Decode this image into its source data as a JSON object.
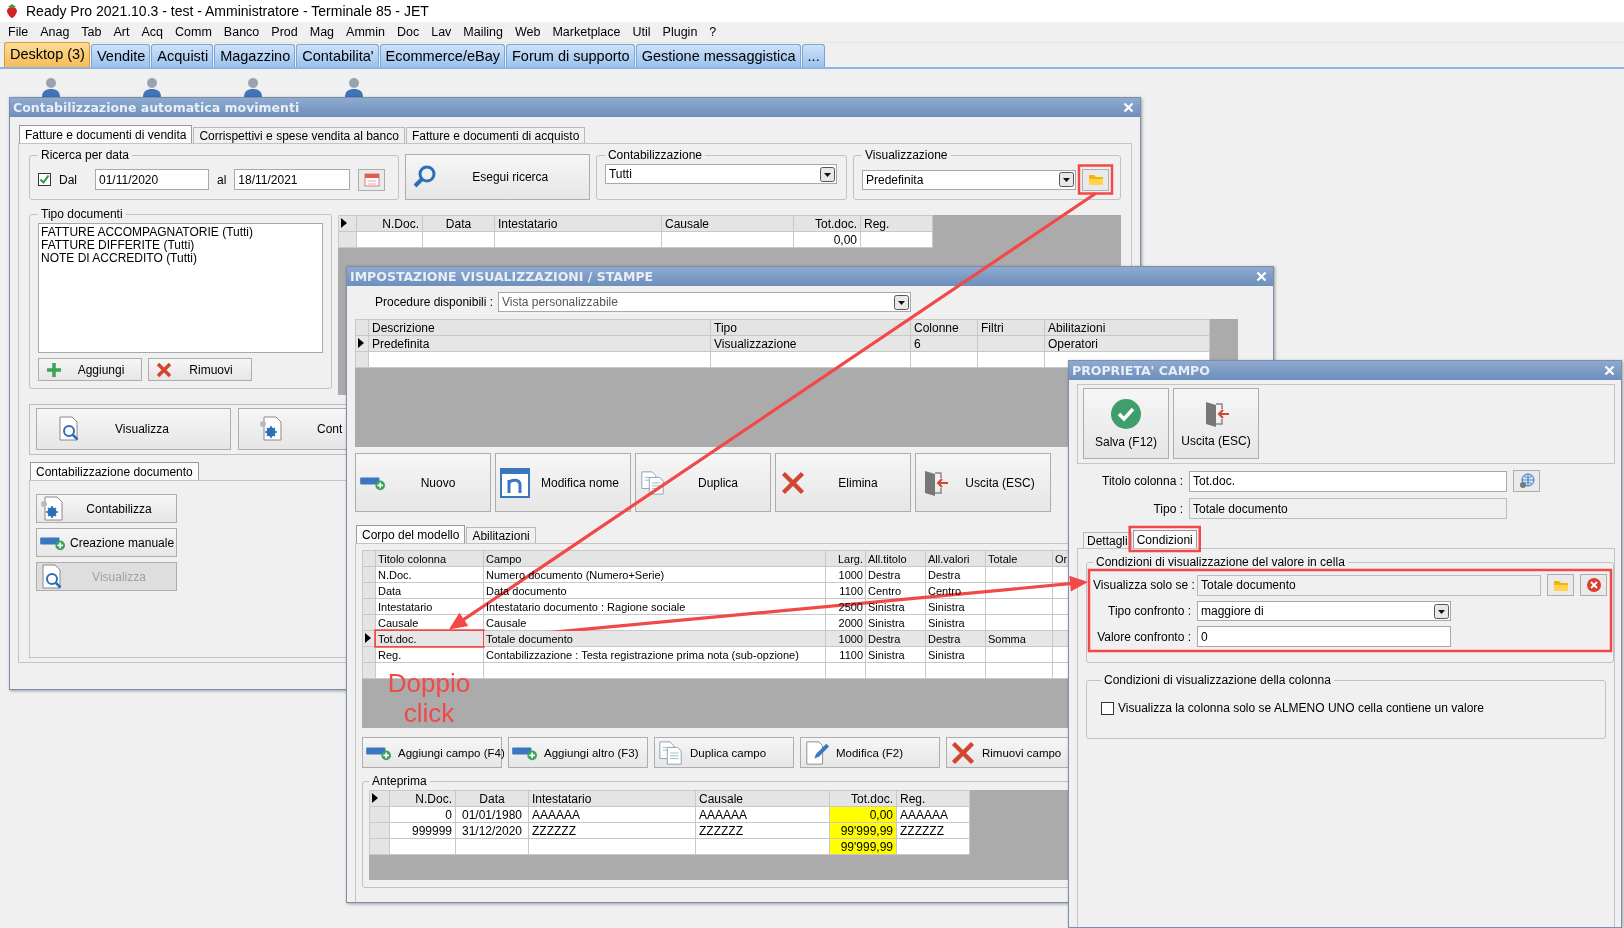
{
  "window": {
    "title": "Ready Pro 2021.10.3 - test - Amministratore - Terminale 85 - JET"
  },
  "menu": [
    "File",
    "Anag",
    "Tab",
    "Art",
    "Acq",
    "Comm",
    "Banco",
    "Prod",
    "Mag",
    "Ammin",
    "Doc",
    "Lav",
    "Mailing",
    "Web",
    "Marketplace",
    "Util",
    "Plugin",
    "?"
  ],
  "desktop_tabs": [
    {
      "label": "Desktop (3)",
      "selected": true
    },
    {
      "label": "Vendite",
      "selected": false
    },
    {
      "label": "Acquisti",
      "selected": false
    },
    {
      "label": "Magazzino",
      "selected": false
    },
    {
      "label": "Contabilita'",
      "selected": false
    },
    {
      "label": "Ecommerce/eBay",
      "selected": false
    },
    {
      "label": "Forum di supporto",
      "selected": false
    },
    {
      "label": "Gestione messaggistica",
      "selected": false
    },
    {
      "label": "...",
      "selected": false
    }
  ],
  "main_window": {
    "title": "Contabilizzazione automatica movimenti",
    "tabs": [
      {
        "label": "Fatture e documenti di vendita",
        "selected": true
      },
      {
        "label": "Corrispettivi e spese vendita al banco",
        "selected": false
      },
      {
        "label": "Fatture e documenti di acquisto",
        "selected": false
      }
    ],
    "date_search": {
      "legend": "Ricerca per data",
      "from_checked": true,
      "from_label": "Dal",
      "from": "01/11/2020",
      "to_label": "al",
      "to": "18/11/2021"
    },
    "search_button": "Esegui ricerca",
    "accounting": {
      "legend": "Contabilizzazione",
      "value": "Tutti"
    },
    "view": {
      "legend": "Visualizzazione",
      "value": "Predefinita"
    },
    "doc_types": {
      "legend": "Tipo documenti",
      "items": [
        "FATTURE ACCOMPAGNATORIE (Tutti)",
        "FATTURE DIFFERITE (Tutti)",
        "NOTE DI ACCREDITO (Tutti)"
      ]
    },
    "add_button": "Aggiungi",
    "remove_button": "Rimuovi",
    "grid": {
      "header_pointer": true,
      "columns": [
        "N.Doc.",
        "Data",
        "Intestatario",
        "Causale",
        "Tot.doc.",
        "Reg."
      ],
      "rows": [
        {
          "cells": [
            null,
            null,
            null,
            null,
            "0,00",
            null
          ]
        }
      ]
    },
    "action_buttons": [
      {
        "label": "Visualizza",
        "kind": "view"
      },
      {
        "label": "Cont",
        "kind": "post"
      }
    ],
    "sub_tabs": [
      {
        "label": "Contabilizzazione documento",
        "selected": true
      }
    ],
    "doc_buttons": [
      {
        "label": "Contabilizza",
        "kind": "post",
        "disabled": false
      },
      {
        "label": "Creazione manuale",
        "kind": "new",
        "disabled": false
      },
      {
        "label": "Visualizza",
        "kind": "view",
        "disabled": true
      }
    ]
  },
  "settings_window": {
    "title": "IMPOSTAZIONE VISUALIZZAZIONI / STAMPE",
    "procedure_label": "Procedure disponibili :",
    "procedure_value": "Vista personalizzabile",
    "models": {
      "columns": [
        "Descrizione",
        "Tipo",
        "Colonne",
        "Filtri",
        "Abilitazioni"
      ],
      "rows": [
        {
          "cells": [
            "Predefinita",
            "Visualizzazione",
            "6",
            null,
            "Operatori"
          ],
          "selected": true
        },
        {
          "cells": [
            null,
            null,
            null,
            null,
            null
          ],
          "selected": false
        }
      ]
    },
    "buttons": [
      {
        "label": "Nuovo",
        "kind": "new"
      },
      {
        "label": "Modifica nome",
        "kind": "rename"
      },
      {
        "label": "Duplica",
        "kind": "copy"
      },
      {
        "label": "Elimina",
        "kind": "delete"
      },
      {
        "label": "Uscita (ESC)",
        "kind": "exit"
      }
    ],
    "tabs": [
      {
        "label": "Corpo del modello",
        "selected": true
      },
      {
        "label": "Abilitazioni",
        "selected": false
      }
    ],
    "fields": {
      "columns": [
        "Titolo colonna",
        "Campo",
        "Larg.",
        "All.titolo",
        "All.valori",
        "Totale",
        "Or"
      ],
      "rows": [
        {
          "cells": [
            "N.Doc.",
            "Numero documento (Numero+Serie)",
            "1000",
            "Destra",
            "Destra",
            null,
            null
          ],
          "selected": false
        },
        {
          "cells": [
            "Data",
            "Data documento",
            "1100",
            "Centro",
            "Centro",
            null,
            null
          ],
          "selected": false
        },
        {
          "cells": [
            "Intestatario",
            "Intestatario documento : Ragione sociale",
            "2500",
            "Sinistra",
            "Sinistra",
            null,
            null
          ],
          "selected": false
        },
        {
          "cells": [
            "Causale",
            "Causale",
            "2000",
            "Sinistra",
            "Sinistra",
            null,
            null
          ],
          "selected": false
        },
        {
          "cells": [
            "Tot.doc.",
            "Totale documento",
            "1000",
            "Destra",
            "Destra",
            "Somma",
            null
          ],
          "selected": true
        },
        {
          "cells": [
            "Reg.",
            "Contabilizzazione : Testa registrazione prima nota (sub-opzione)",
            "1100",
            "Sinistra",
            "Sinistra",
            null,
            null
          ],
          "selected": false
        },
        {
          "cells": [
            null,
            null,
            null,
            null,
            null,
            null,
            null
          ],
          "selected": false
        }
      ]
    },
    "field_buttons": [
      {
        "label": "Aggiungi campo (F4)",
        "kind": "new"
      },
      {
        "label": "Aggiungi altro (F3)",
        "kind": "new"
      },
      {
        "label": "Duplica campo",
        "kind": "copy"
      },
      {
        "label": "Modifica (F2)",
        "kind": "edit"
      },
      {
        "label": "Rimuovi campo",
        "kind": "delete"
      }
    ],
    "preview": {
      "legend": "Anteprima",
      "header_pointer": true,
      "columns": [
        {
          "label": "N.Doc."
        },
        {
          "label": "Data"
        },
        {
          "label": "Intestatario"
        },
        {
          "label": "Causale"
        },
        {
          "label": "Tot.doc.",
          "highlight": true
        },
        {
          "label": "Reg."
        }
      ],
      "rows": [
        {
          "cells": [
            "0",
            "01/01/1980",
            "AAAAAA",
            "AAAAAA",
            "0,00",
            "AAAAAA"
          ]
        },
        {
          "cells": [
            "999999",
            "31/12/2020",
            "ZZZZZZ",
            "ZZZZZZ",
            "99'999,99",
            "ZZZZZZ"
          ]
        },
        {
          "cells": [
            null,
            null,
            null,
            null,
            "99'999,99",
            null
          ]
        }
      ]
    }
  },
  "field_window": {
    "title": "PROPRIETA' CAMPO",
    "buttons": [
      {
        "label": "Salva (F12)",
        "kind": "save"
      },
      {
        "label": "Uscita (ESC)",
        "kind": "exit"
      }
    ],
    "fields": [
      {
        "kind": "text",
        "label": "Titolo colonna :",
        "value": "Tot.doc.",
        "read_only": false,
        "actions": [
          {
            "kind": "globe"
          }
        ]
      },
      {
        "kind": "text",
        "label": "Tipo :",
        "value": "Totale documento",
        "read_only": true
      }
    ],
    "tabs": [
      {
        "label": "Dettagli",
        "selected": false
      },
      {
        "label": "Condizioni",
        "selected": true
      }
    ],
    "cell_conditions": {
      "legend": "Condizioni di visualizzazione del valore in cella",
      "fields": [
        {
          "kind": "text",
          "label": "Visualizza solo se :",
          "value": "Totale documento",
          "read_only": true,
          "actions": [
            {
              "kind": "folder"
            },
            {
              "kind": "clear"
            }
          ]
        },
        {
          "kind": "select",
          "label": "Tipo confronto :",
          "value": "maggiore di"
        },
        {
          "kind": "text",
          "label": "Valore confronto :",
          "value": "0",
          "read_only": false
        }
      ]
    },
    "column_conditions": {
      "legend": "Condizioni di visualizzazione della colonna",
      "checkbox": {
        "label": "Visualizza la colonna solo se ALMENO UNO cella contiene un valore",
        "checked": false
      }
    }
  },
  "annotation": {
    "text": "Doppio click"
  }
}
